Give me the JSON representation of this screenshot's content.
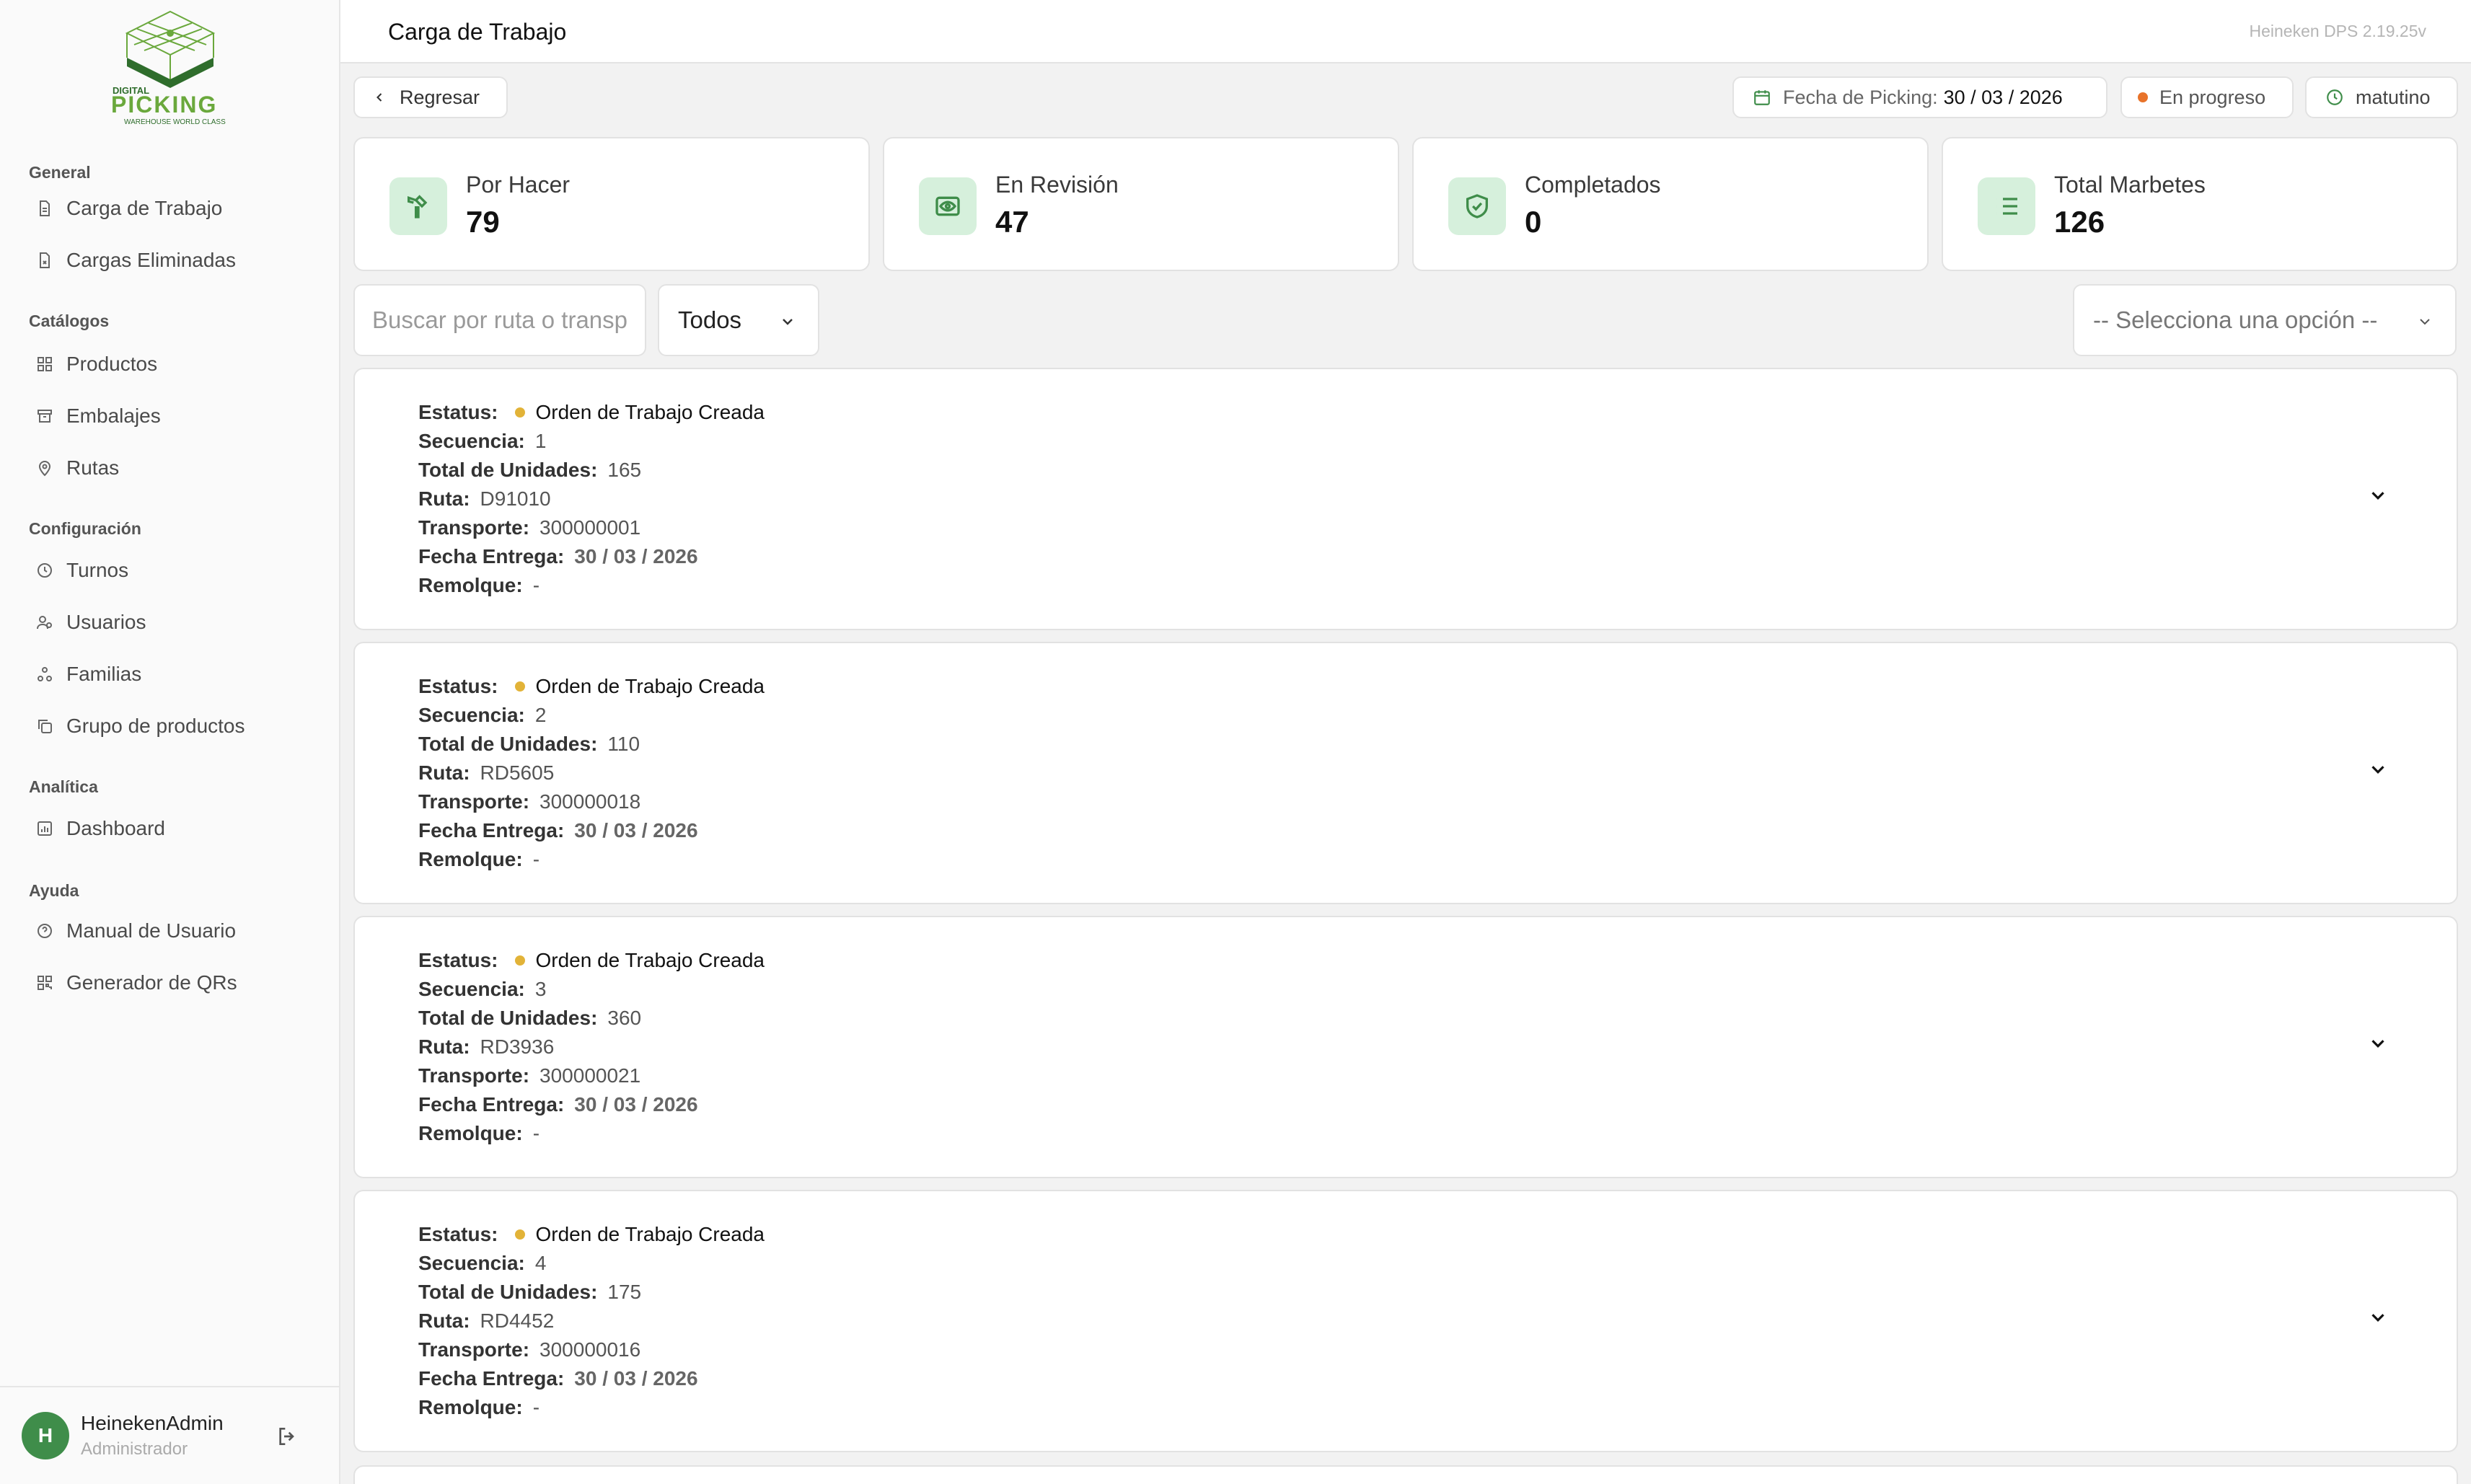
{
  "sidebar": {
    "logo": {
      "line1": "DIGITAL",
      "line2": "PICKING",
      "tagline": "WAREHOUSE WORLD CLASS",
      "color": "#6aa83c"
    },
    "groups": [
      {
        "title": "General",
        "items": [
          {
            "label": "Carga de Trabajo",
            "icon": "file-icon"
          },
          {
            "label": "Cargas Eliminadas",
            "icon": "file-x-icon"
          }
        ]
      },
      {
        "title": "Catálogos",
        "items": [
          {
            "label": "Productos",
            "icon": "grid-icon"
          },
          {
            "label": "Embalajes",
            "icon": "archive-icon"
          },
          {
            "label": "Rutas",
            "icon": "map-pin-icon"
          }
        ]
      },
      {
        "title": "Configuración",
        "items": [
          {
            "label": "Turnos",
            "icon": "clock-icon"
          },
          {
            "label": "Usuarios",
            "icon": "users-icon"
          },
          {
            "label": "Familias",
            "icon": "family-icon"
          },
          {
            "label": "Grupo de productos",
            "icon": "copy-icon"
          }
        ]
      },
      {
        "title": "Analítica",
        "items": [
          {
            "label": "Dashboard",
            "icon": "chart-icon"
          }
        ]
      },
      {
        "title": "Ayuda",
        "items": [
          {
            "label": "Manual de Usuario",
            "icon": "help-icon"
          },
          {
            "label": "Generador de QRs",
            "icon": "qr-icon"
          }
        ]
      }
    ],
    "user": {
      "initial": "H",
      "name": "HeinekenAdmin",
      "role": "Administrador"
    }
  },
  "header": {
    "title": "Carga de Trabajo",
    "version": "Heineken DPS 2.19.25v"
  },
  "toolbar": {
    "back_label": "Regresar",
    "picking_label": "Fecha de Picking:",
    "picking_date": "30 / 03 / 2026",
    "status_label": "En progreso",
    "status_color": "#e8732a",
    "shift_label": "matutino"
  },
  "stats": [
    {
      "label": "Por Hacer",
      "value": "79",
      "icon": "hammer-icon"
    },
    {
      "label": "En Revisión",
      "value": "47",
      "icon": "eye-icon"
    },
    {
      "label": "Completados",
      "value": "0",
      "icon": "shield-check-icon"
    },
    {
      "label": "Total Marbetes",
      "value": "126",
      "icon": "list-icon"
    }
  ],
  "filters": {
    "search_placeholder": "Buscar por ruta o transporte",
    "status_filter": "Todos",
    "option_placeholder": "-- Selecciona una opción --"
  },
  "field_labels": {
    "status": "Estatus:",
    "sequence": "Secuencia:",
    "units": "Total de Unidades:",
    "route": "Ruta:",
    "transport": "Transporte:",
    "delivery": "Fecha Entrega:",
    "trailer": "Remolque:"
  },
  "orders": [
    {
      "status": "Orden de Trabajo Creada",
      "sequence": "1",
      "units": "165",
      "route": "D91010",
      "transport": "300000001",
      "delivery": "30 / 03 / 2026",
      "trailer": "-"
    },
    {
      "status": "Orden de Trabajo Creada",
      "sequence": "2",
      "units": "110",
      "route": "RD5605",
      "transport": "300000018",
      "delivery": "30 / 03 / 2026",
      "trailer": "-"
    },
    {
      "status": "Orden de Trabajo Creada",
      "sequence": "3",
      "units": "360",
      "route": "RD3936",
      "transport": "300000021",
      "delivery": "30 / 03 / 2026",
      "trailer": "-"
    },
    {
      "status": "Orden de Trabajo Creada",
      "sequence": "4",
      "units": "175",
      "route": "RD4452",
      "transport": "300000016",
      "delivery": "30 / 03 / 2026",
      "trailer": "-"
    }
  ],
  "colors": {
    "accent": "#3f8d4a",
    "icon_bg": "#d6f0dc",
    "status_dot": "#e2b338"
  }
}
